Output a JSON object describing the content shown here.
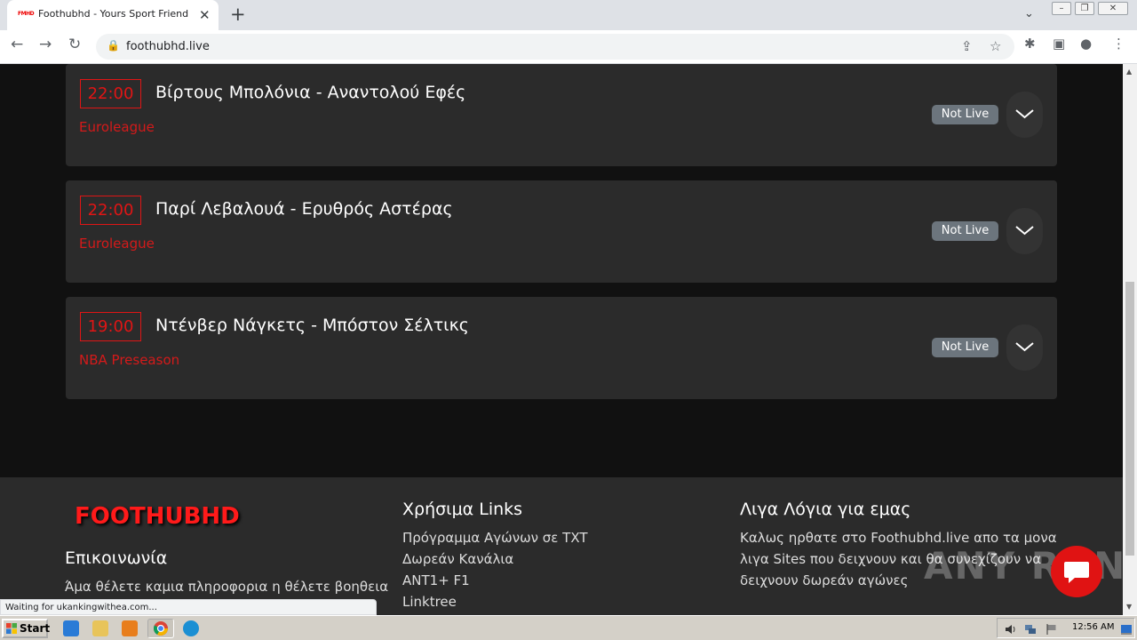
{
  "browser": {
    "tab_title": "Foothubhd - Yours Sport Friend",
    "tab_favicon_text": "FMHD",
    "tab_close": "✕",
    "new_tab": "+",
    "url": "foothubhd.live",
    "status_text": "Waiting for ukankingwithea.com..."
  },
  "matches": [
    {
      "time": "22:00",
      "teams": "Βίρτους Μπολόνια - Αναντολού Εφές",
      "league": "Euroleague",
      "status": "Not Live"
    },
    {
      "time": "22:00",
      "teams": "Παρί Λεβαλουά - Ερυθρός Αστέρας",
      "league": "Euroleague",
      "status": "Not Live"
    },
    {
      "time": "19:00",
      "teams": "Ντένβερ Νάγκετς - Μπόστον Σέλτικς",
      "league": "NBA Preseason",
      "status": "Not Live"
    }
  ],
  "footer": {
    "brand": "FOOTHUBHD",
    "contact_heading": "Επικοινωνία",
    "contact_text": "Άμα θέλετε καμια πληροφορια η θέλετε βοηθεια",
    "links_heading": "Χρήσιμα Links",
    "links": [
      "Πρόγραμμα Αγώνων σε TXT",
      "Δωρεάν Κανάλια",
      "ANT1+ F1",
      "Linktree"
    ],
    "about_heading": "Λιγα Λόγια για εμας",
    "about_lines": [
      "Καλως ηρθατε στο Foothubhd.live απο τα μονα",
      "λιγα Sites που δειχνουν και θα συνεχίζουν να",
      "δειχνουν δωρεάν αγώνες"
    ]
  },
  "watermark": "ANY RUN",
  "taskbar": {
    "start_label": "Start",
    "clock": "12:56 AM"
  },
  "colors": {
    "accent_red": "#e01515",
    "card_bg": "#2b2b2b",
    "page_bg": "#111111",
    "badge_gray": "#6c757d"
  }
}
